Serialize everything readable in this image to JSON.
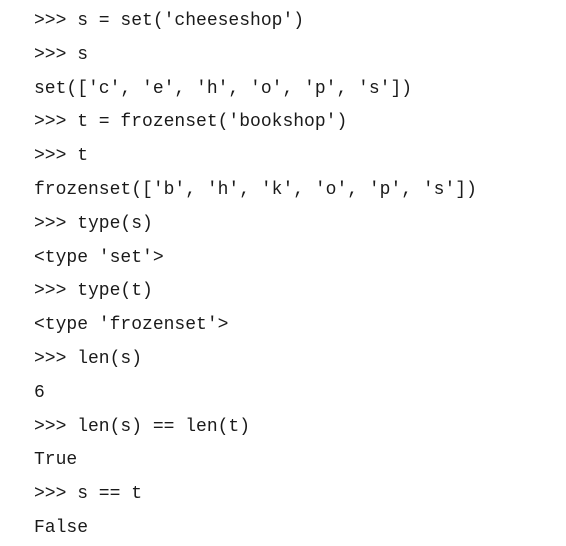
{
  "console": {
    "lines": [
      ">>> s = set('cheeseshop')",
      ">>> s",
      "set(['c', 'e', 'h', 'o', 'p', 's'])",
      ">>> t = frozenset('bookshop')",
      ">>> t",
      "frozenset(['b', 'h', 'k', 'o', 'p', 's'])",
      ">>> type(s)",
      "<type 'set'>",
      ">>> type(t)",
      "<type 'frozenset'>",
      ">>> len(s)",
      "6",
      ">>> len(s) == len(t)",
      "True",
      ">>> s == t",
      "False"
    ]
  }
}
